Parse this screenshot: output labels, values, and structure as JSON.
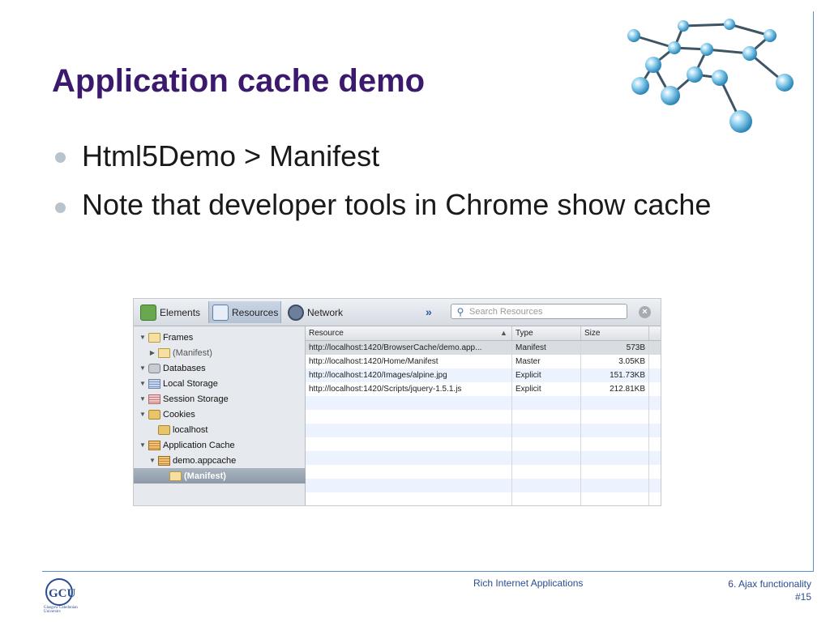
{
  "slide": {
    "title": "Application cache demo",
    "bullets": [
      "Html5Demo > Manifest",
      "Note that developer tools in Chrome show cache"
    ]
  },
  "devtools": {
    "tabs": [
      {
        "label": "Elements",
        "icon": "elements-icon"
      },
      {
        "label": "Resources",
        "icon": "resources-icon",
        "active": true
      },
      {
        "label": "Network",
        "icon": "network-icon"
      }
    ],
    "more": "»",
    "search": {
      "placeholder": "Search Resources",
      "value": ""
    },
    "tree": [
      {
        "label": "Frames",
        "expanded": true,
        "icon": "folder-icon"
      },
      {
        "label": "(Manifest)",
        "expanded": false,
        "icon": "folder-icon"
      },
      {
        "label": "Databases",
        "expanded": true,
        "icon": "database-icon"
      },
      {
        "label": "Local Storage",
        "expanded": true,
        "icon": "local-storage-icon"
      },
      {
        "label": "Session Storage",
        "expanded": true,
        "icon": "session-storage-icon"
      },
      {
        "label": "Cookies",
        "expanded": true,
        "icon": "cookie-icon"
      },
      {
        "label": "localhost",
        "icon": "cookie-icon"
      },
      {
        "label": "Application Cache",
        "expanded": true,
        "icon": "application-cache-icon"
      },
      {
        "label": "demo.appcache",
        "expanded": true,
        "icon": "application-cache-icon"
      },
      {
        "label": "(Manifest)",
        "selected": true,
        "icon": "folder-icon"
      }
    ],
    "grid": {
      "columns": [
        "Resource",
        "Type",
        "Size"
      ],
      "rows": [
        {
          "resource": "http://localhost:1420/BrowserCache/demo.app...",
          "type": "Manifest",
          "size": "573B"
        },
        {
          "resource": "http://localhost:1420/Home/Manifest",
          "type": "Master",
          "size": "3.05KB"
        },
        {
          "resource": "http://localhost:1420/Images/alpine.jpg",
          "type": "Explicit",
          "size": "151.73KB"
        },
        {
          "resource": "http://localhost:1420/Scripts/jquery-1.5.1.js",
          "type": "Explicit",
          "size": "212.81KB"
        }
      ]
    }
  },
  "footer": {
    "course": "Rich Internet Applications",
    "section": "6. Ajax functionality",
    "page": "#15",
    "logo_text": "GCU",
    "logo_subtext": "Glasgow Caledonian University"
  },
  "colors": {
    "title": "#3b1a6e",
    "accent_rule": "#5b8fc9",
    "footer_text": "#2a4d8f"
  }
}
